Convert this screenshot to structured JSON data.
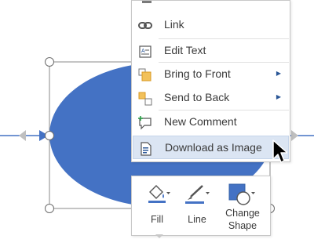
{
  "context_menu": {
    "items": [
      {
        "label": "Link",
        "icon": "link-icon",
        "has_submenu": false
      },
      {
        "label": "Edit Text",
        "icon": "edit-text-icon",
        "has_submenu": false
      },
      {
        "label": "Bring to Front",
        "icon": "bring-to-front-icon",
        "has_submenu": true
      },
      {
        "label": "Send to Back",
        "icon": "send-to-back-icon",
        "has_submenu": true
      },
      {
        "label": "New Comment",
        "icon": "new-comment-icon",
        "has_submenu": false
      },
      {
        "label": "Download as Image",
        "icon": "download-image-icon",
        "has_submenu": false,
        "highlighted": true
      }
    ]
  },
  "mini_toolbar": {
    "fill_label": "Fill",
    "line_label": "Line",
    "change_shape_label_1": "Change",
    "change_shape_label_2": "Shape"
  },
  "colors": {
    "shape_fill": "#4472c4",
    "connector": "#4472c4",
    "highlight_bg": "#dbe5f3",
    "accent": "#2b5797"
  }
}
